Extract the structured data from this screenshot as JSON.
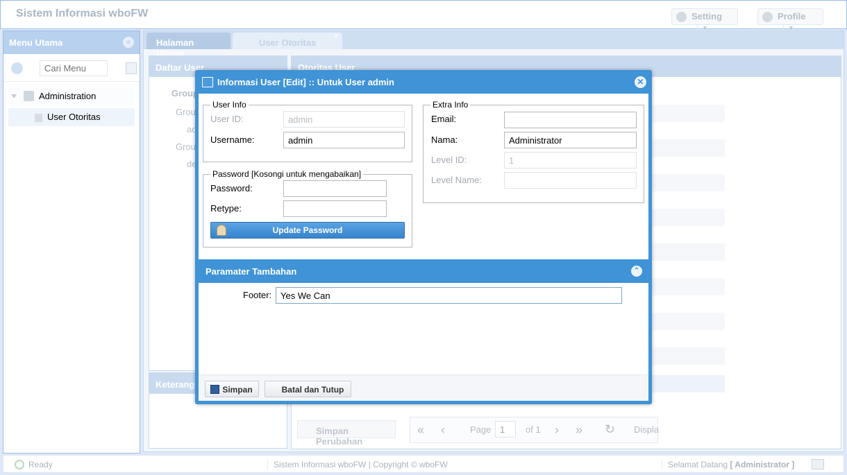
{
  "app": {
    "title": "Sistem Informasi wboFW",
    "setting_label": "Setting",
    "profile_label": "Profile"
  },
  "west": {
    "title": "Menu Utama",
    "search_placeholder": "Cari Menu",
    "tree": [
      {
        "label": "Administration"
      },
      {
        "label": "User Otoritas"
      }
    ]
  },
  "tabs": [
    {
      "label": "Halaman Utama"
    },
    {
      "label": "User Otoritas",
      "close": "×"
    }
  ],
  "panels": {
    "daftar_user": "Daftar User",
    "keterangan": "Keterang",
    "otoritas_user": "Otoritas User",
    "daftar_items": [
      "Group",
      "Grou",
      "ad",
      "Grou",
      "de"
    ]
  },
  "pager": {
    "save_changes": "Simpan Perubahan",
    "page_label": "Page",
    "page_value": "1",
    "of_label": "of 1",
    "display_label": "Displa"
  },
  "status": {
    "ready": "Ready",
    "copyright": "Sistem Informasi wboFW | Copyright © wboFW",
    "welcome_prefix": "Selamat Datang",
    "welcome_user": "[ Administrator ]"
  },
  "modal": {
    "title": "Informasi User [Edit] :: Untuk User admin",
    "close": "✕",
    "user_info": {
      "legend": "User Info",
      "user_id_label": "User ID:",
      "user_id_value": "admin",
      "username_label": "Username:",
      "username_value": "admin"
    },
    "password": {
      "legend": "Password [Kosongi untuk mengabaikan]",
      "password_label": "Password:",
      "password_value": "",
      "retype_label": "Retype:",
      "retype_value": "",
      "update_button": "Update Password"
    },
    "extra_info": {
      "legend": "Extra Info",
      "email_label": "Email:",
      "email_value": "",
      "nama_label": "Nama:",
      "nama_value": "Administrator",
      "level_id_label": "Level ID:",
      "level_id_value": "1",
      "level_name_label": "Level Name:",
      "level_name_value": ""
    },
    "param": {
      "title": "Paramater Tambahan",
      "toggle": "⌃",
      "footer_label": "Footer:",
      "footer_value": "Yes We Can"
    },
    "buttons": {
      "save": "Simpan",
      "cancel": "Batal dan Tutup"
    }
  },
  "colors": {
    "accent": "#3f93d6",
    "header_text": "#ffffff",
    "page_bg": "#dfe8f6"
  }
}
